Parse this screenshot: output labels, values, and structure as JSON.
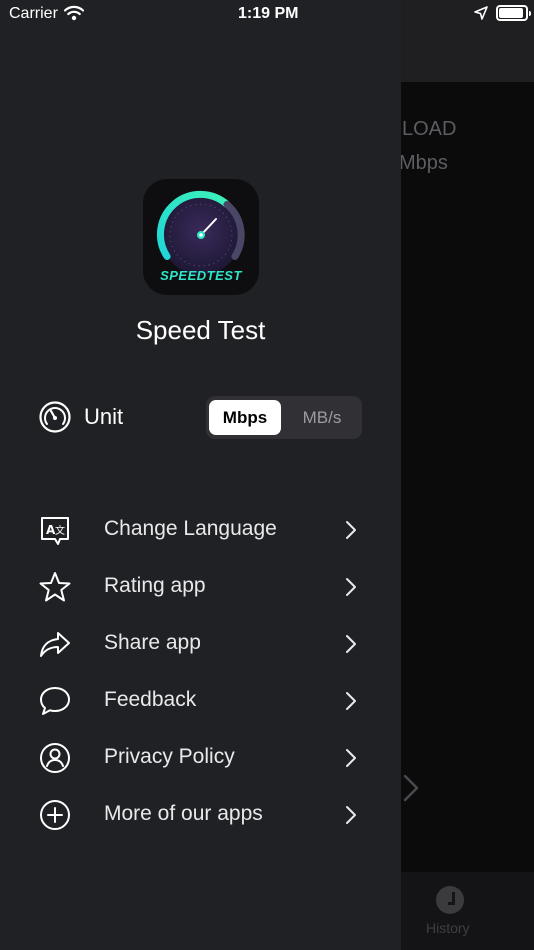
{
  "status_bar": {
    "carrier": "Carrier",
    "time": "1:19 PM"
  },
  "background_screen": {
    "label_top": "LOAD",
    "label_unit": "Mbps",
    "tab_history": "History"
  },
  "drawer": {
    "app_icon_text": "SPEEDTEST",
    "app_title": "Speed Test",
    "unit": {
      "label": "Unit",
      "options": [
        "Mbps",
        "MB/s"
      ],
      "selected": "Mbps"
    },
    "menu": [
      {
        "label": "Change Language",
        "icon": "translate-icon"
      },
      {
        "label": "Rating app",
        "icon": "star-icon"
      },
      {
        "label": "Share app",
        "icon": "share-icon"
      },
      {
        "label": "Feedback",
        "icon": "chat-bubble-icon"
      },
      {
        "label": "Privacy Policy",
        "icon": "user-circle-icon"
      },
      {
        "label": "More of our apps",
        "icon": "plus-circle-icon"
      }
    ]
  },
  "colors": {
    "drawer_bg": "#202124",
    "accent_teal": "#2ee6c8",
    "segment_bg": "#313135"
  }
}
